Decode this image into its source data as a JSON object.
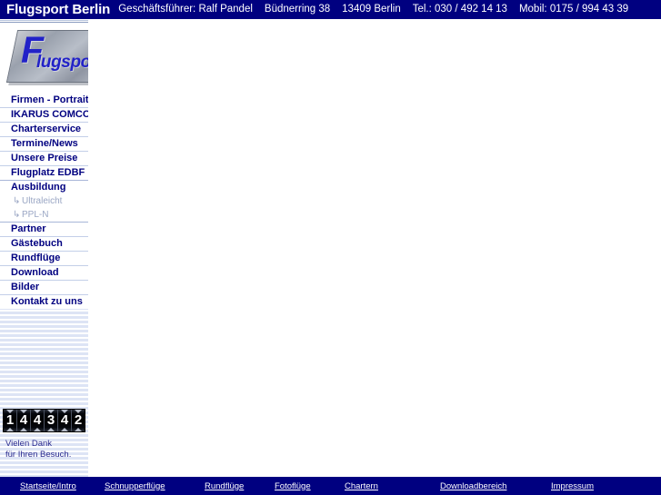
{
  "header": {
    "brand": "Flugsport Berlin",
    "contact_segments": [
      "Geschäftsführer: Ralf Pandel",
      "Büdnerring 38",
      "13409 Berlin",
      "Tel.: 030 / 492 14 13",
      "Mobil: 0175 / 994 43 39"
    ]
  },
  "logo": {
    "letter": "F",
    "word": "lugsport",
    "alt": "Flugsport"
  },
  "sidebar": {
    "menu": [
      {
        "label": "Firmen - Portrait",
        "type": "item"
      },
      {
        "label": "IKARUS COMCO",
        "type": "item"
      },
      {
        "label": "Charterservice",
        "type": "item"
      },
      {
        "label": "Termine/News",
        "type": "item"
      },
      {
        "label": "Unsere Preise",
        "type": "item"
      },
      {
        "label": "Flugplatz EDBF",
        "type": "item"
      },
      {
        "label": "Ausbildung",
        "type": "item"
      },
      {
        "label": "Ultraleicht",
        "type": "sub",
        "arrow": "↳"
      },
      {
        "label": "PPL-N",
        "type": "sub",
        "arrow": "↳"
      },
      {
        "label": "Partner",
        "type": "item"
      },
      {
        "label": "Gästebuch",
        "type": "item"
      },
      {
        "label": "Rundflüge",
        "type": "item"
      },
      {
        "label": "Download",
        "type": "item"
      },
      {
        "label": "Bilder",
        "type": "item"
      },
      {
        "label": "Kontakt zu uns",
        "type": "item"
      }
    ],
    "counter": {
      "value": "144342",
      "digits": [
        "1",
        "4",
        "4",
        "3",
        "4",
        "2"
      ]
    },
    "thanks_line1": "Vielen Dank",
    "thanks_line2": "für Ihren Besuch."
  },
  "footer": {
    "links": [
      "Startseite/Intro",
      "Schnupperflüge",
      "Rundflüge",
      "Fotoflüge",
      "Chartern",
      "Downloadbereich",
      "Impressum"
    ]
  },
  "colors": {
    "navy": "#000080",
    "logo_blue": "#2222c8",
    "sidebar_stripe": "#dde4f5",
    "menu_text": "#000080",
    "submenu_text": "#9aa6c4"
  }
}
